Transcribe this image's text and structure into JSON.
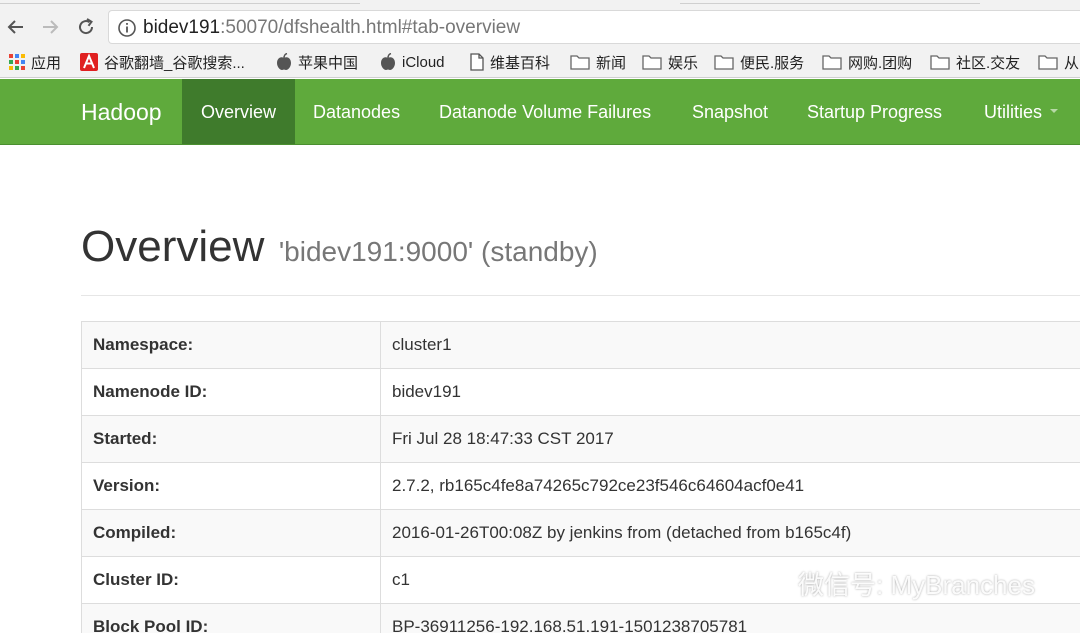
{
  "browser": {
    "url_host": "bidev191",
    "url_rest": ":50070/dfshealth.html#tab-overview",
    "bookmarks": [
      {
        "label": "应用",
        "icon": "apps-grid-icon"
      },
      {
        "label": "谷歌翻墙_谷歌搜索...",
        "icon": "red-a-icon"
      },
      {
        "label": "苹果中国",
        "icon": "apple-icon"
      },
      {
        "label": "iCloud",
        "icon": "apple-icon"
      },
      {
        "label": "维基百科",
        "icon": "page-icon"
      },
      {
        "label": "新闻",
        "icon": "folder-icon"
      },
      {
        "label": "娱乐",
        "icon": "folder-icon"
      },
      {
        "label": "便民.服务",
        "icon": "folder-icon"
      },
      {
        "label": "网购.团购",
        "icon": "folder-icon"
      },
      {
        "label": "社区.交友",
        "icon": "folder-icon"
      },
      {
        "label": "从",
        "icon": "folder-icon"
      }
    ]
  },
  "navbar": {
    "brand": "Hadoop",
    "items": [
      {
        "label": "Overview",
        "active": true
      },
      {
        "label": "Datanodes"
      },
      {
        "label": "Datanode Volume Failures"
      },
      {
        "label": "Snapshot"
      },
      {
        "label": "Startup Progress"
      },
      {
        "label": "Utilities",
        "dropdown": true
      }
    ],
    "bg_color": "#5faa3c",
    "active_color": "#3f7b2c"
  },
  "header": {
    "title": "Overview",
    "subtitle": "'bidev191:9000' (standby)"
  },
  "overview": {
    "rows": [
      {
        "key": "Namespace:",
        "value": "cluster1"
      },
      {
        "key": "Namenode ID:",
        "value": "bidev191"
      },
      {
        "key": "Started:",
        "value": "Fri Jul 28 18:47:33 CST 2017"
      },
      {
        "key": "Version:",
        "value": "2.7.2, rb165c4fe8a74265c792ce23f546c64604acf0e41"
      },
      {
        "key": "Compiled:",
        "value": "2016-01-26T00:08Z by jenkins from (detached from b165c4f)"
      },
      {
        "key": "Cluster ID:",
        "value": "c1"
      },
      {
        "key": "Block Pool ID:",
        "value": "BP-36911256-192.168.51.191-1501238705781"
      }
    ]
  },
  "watermark": {
    "text": "微信号: MyBranches"
  }
}
